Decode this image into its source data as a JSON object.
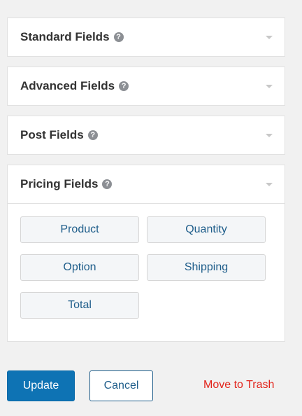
{
  "panels": [
    {
      "title": "Standard Fields",
      "expanded": false
    },
    {
      "title": "Advanced Fields",
      "expanded": false
    },
    {
      "title": "Post Fields",
      "expanded": false
    },
    {
      "title": "Pricing Fields",
      "expanded": true,
      "buttons": [
        "Product",
        "Quantity",
        "Option",
        "Shipping",
        "Total"
      ]
    }
  ],
  "help_icon_glyph": "?",
  "footer": {
    "update_label": "Update",
    "cancel_label": "Cancel",
    "trash_label": "Move to Trash"
  },
  "colors": {
    "update_button": "#0e73b4",
    "trash_link": "#e2231a",
    "field_button_text": "#1e5d8a"
  }
}
